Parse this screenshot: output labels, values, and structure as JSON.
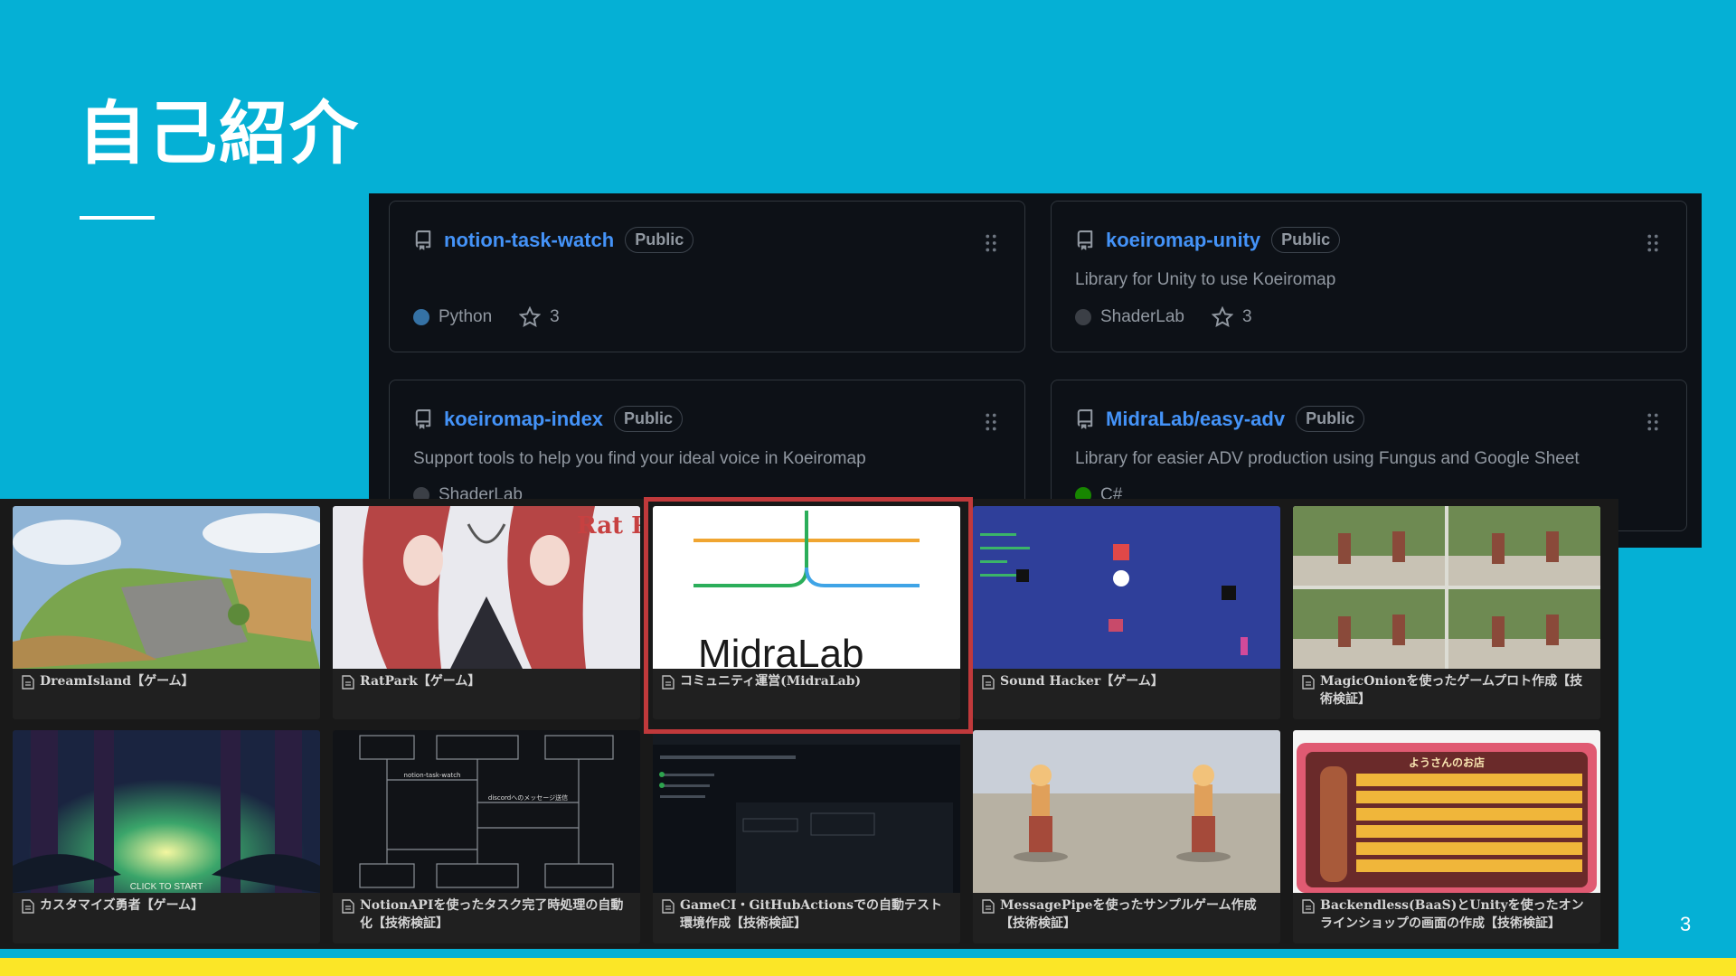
{
  "slide": {
    "title": "自己紹介",
    "page_number": "3"
  },
  "colors": {
    "background": "#05b0d5",
    "bottom_bar": "#fbe627",
    "link": "#4493f8",
    "highlight": "#c0393b"
  },
  "github_repos": [
    {
      "name": "notion-task-watch",
      "visibility": "Public",
      "description": "",
      "language": "Python",
      "language_color": "#3572A5",
      "stars": "3"
    },
    {
      "name": "koeiromap-unity",
      "visibility": "Public",
      "description": "Library for Unity to use Koeiromap",
      "language": "ShaderLab",
      "language_color": "#222c37",
      "stars": "3"
    },
    {
      "name": "koeiromap-index",
      "visibility": "Public",
      "description": "Support tools to help you find your ideal voice in Koeiromap",
      "language": "ShaderLab",
      "language_color": "#222c37",
      "stars": ""
    },
    {
      "name": "MidraLab/easy-adv",
      "visibility": "Public",
      "description": "Library for easier ADV production using Fungus and Google Sheet",
      "language": "C#",
      "language_color": "#178600",
      "stars": ""
    }
  ],
  "gallery": [
    {
      "title": "DreamIsland【ゲーム】",
      "thumb": "island-map"
    },
    {
      "title": "RatPark【ゲーム】",
      "thumb": "ratpark-art",
      "thumb_text": "Rat Park"
    },
    {
      "title": "コミュニティ運営(MidraLab)",
      "thumb": "midralab-logo",
      "thumb_text": "MidraLab",
      "selected": true
    },
    {
      "title": "Sound Hacker【ゲーム】",
      "thumb": "sound-hacker"
    },
    {
      "title": "MagicOnionを使ったゲームプロト作成【技術検証】",
      "thumb": "magiconion-grid"
    },
    {
      "title": "カスタマイズ勇者【ゲーム】",
      "thumb": "forest-hero",
      "thumb_text": "CLICK TO START"
    },
    {
      "title": "NotionAPIを使ったタスク完了時処理の自動化【技術検証】",
      "thumb": "sequence-diagram",
      "thumb_text": [
        "notion-task-watch",
        "discordへのメッセージ送信"
      ]
    },
    {
      "title": "GameCI・GitHubActionsでの自動テスト環境作成【技術検証】",
      "thumb": "github-actions"
    },
    {
      "title": "MessagePipeを使ったサンプルゲーム作成【技術検証】",
      "thumb": "characters-floor"
    },
    {
      "title": "Backendless(BaaS)とUnityを使ったオンラインショップの画面の作成【技術検証】",
      "thumb": "shop-ui",
      "thumb_text": "ようさんのお店"
    }
  ]
}
